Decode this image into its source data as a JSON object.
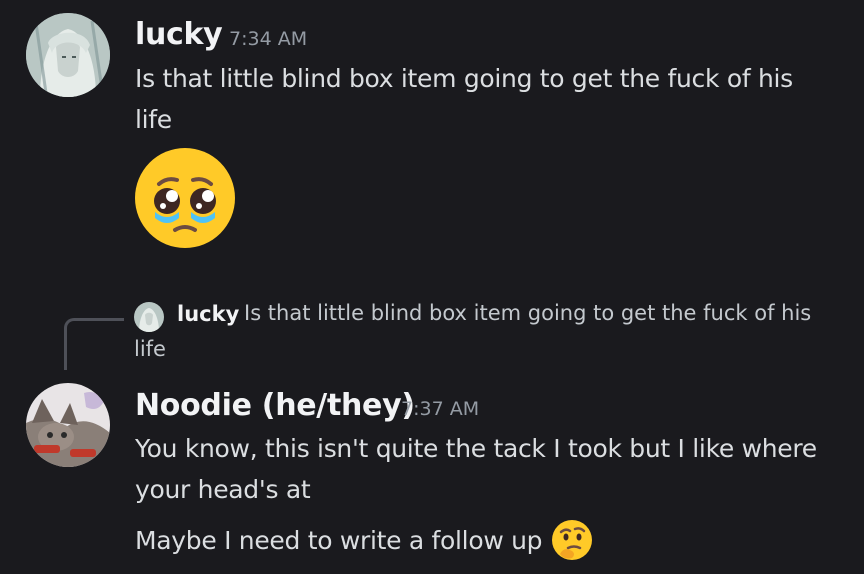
{
  "messages": [
    {
      "author": "lucky",
      "time": "7:34 AM",
      "lines": [
        "Is that little blind box item going to get the fuck of his",
        "life"
      ],
      "emoji": "pleading-face"
    },
    {
      "author": "Noodie (he/they)",
      "time": "7:37 AM",
      "reply": {
        "author": "lucky",
        "text": "Is that little blind box item going to get the fuck of his",
        "text_line2": "life"
      },
      "lines": [
        "You know, this isn't quite the tack I took but I like where",
        "your head's at"
      ],
      "followup": "Maybe I need to write a follow up",
      "followup_emoji": "thinking-face"
    }
  ],
  "colors": {
    "background": "#1a1a1e",
    "username": "#f2f3f5",
    "timestamp": "#949ba4",
    "text": "#dbdee1"
  }
}
